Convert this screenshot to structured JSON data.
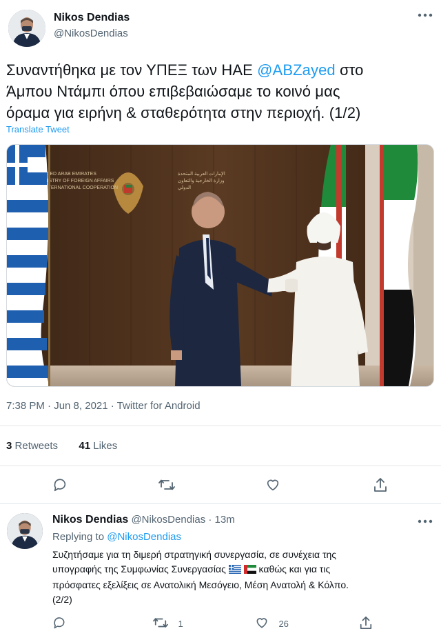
{
  "main_tweet": {
    "author_name": "Nikos Dendias",
    "author_handle": "@NikosDendias",
    "text_prefix": "Συναντήθηκα με τον ΥΠΕΞ των ΗΑΕ ",
    "mention": "@ABZayed",
    "text_line1_suffix": " στο",
    "text_line2": "Άμπου Ντάμπι όπου επιβεβαιώσαμε το κοινό μας",
    "text_line3": "όραμα για ειρήνη & σταθερότητα στην περιοχή. (1/2)",
    "translate_label": "Translate Tweet",
    "photo_description": "Two men elbow-bumping in front of Greek and UAE flags",
    "photo_wall_text_left": "UNITED ARAB EMIRATES\nMINISTRY OF FOREIGN AFFAIRS\n& INTERNATIONAL COOPERATION",
    "timestamp": "7:38 PM · Jun 8, 2021 · Twitter for Android",
    "retweets_count": "3",
    "retweets_label": "Retweets",
    "likes_count": "41",
    "likes_label": "Likes"
  },
  "reply_tweet": {
    "author_name": "Nikos Dendias",
    "author_handle": "@NikosDendias",
    "time_ago": "· 13m",
    "replying_to_label": "Replying to ",
    "replying_to_handle": "@NikosDendias",
    "line1": "Συζητήσαμε για τη διμερή στρατηγική συνεργασία, σε συνέχεια της",
    "line2_before_flags": "υπογραφής της Συμφωνίας Συνεργασίας ",
    "line2_after_flags": " καθώς και για τις",
    "line3": "πρόσφατες εξελίξεις σε Ανατολική Μεσόγειο, Μέση Ανατολή & Κόλπο.",
    "line4": "(2/2)",
    "retweet_count": "1",
    "like_count": "26"
  },
  "colors": {
    "accent": "#1d9bf0",
    "muted": "#536471",
    "text": "#0f1419",
    "divider": "#e1e6ea"
  },
  "icons": [
    "more-icon",
    "reply-icon",
    "retweet-icon",
    "like-icon",
    "share-icon"
  ]
}
